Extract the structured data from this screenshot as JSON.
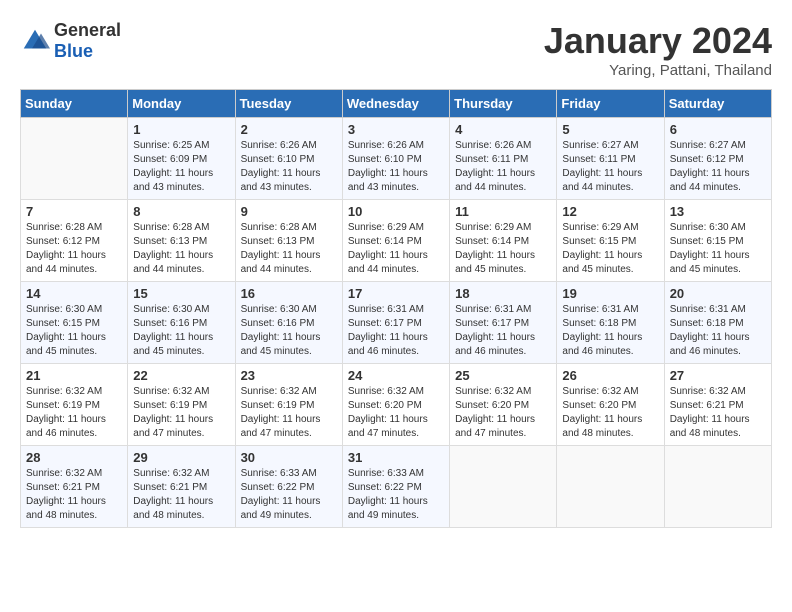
{
  "header": {
    "logo_general": "General",
    "logo_blue": "Blue",
    "month": "January 2024",
    "location": "Yaring, Pattani, Thailand"
  },
  "columns": [
    "Sunday",
    "Monday",
    "Tuesday",
    "Wednesday",
    "Thursday",
    "Friday",
    "Saturday"
  ],
  "weeks": [
    [
      {
        "day": "",
        "info": ""
      },
      {
        "day": "1",
        "info": "Sunrise: 6:25 AM\nSunset: 6:09 PM\nDaylight: 11 hours\nand 43 minutes."
      },
      {
        "day": "2",
        "info": "Sunrise: 6:26 AM\nSunset: 6:10 PM\nDaylight: 11 hours\nand 43 minutes."
      },
      {
        "day": "3",
        "info": "Sunrise: 6:26 AM\nSunset: 6:10 PM\nDaylight: 11 hours\nand 43 minutes."
      },
      {
        "day": "4",
        "info": "Sunrise: 6:26 AM\nSunset: 6:11 PM\nDaylight: 11 hours\nand 44 minutes."
      },
      {
        "day": "5",
        "info": "Sunrise: 6:27 AM\nSunset: 6:11 PM\nDaylight: 11 hours\nand 44 minutes."
      },
      {
        "day": "6",
        "info": "Sunrise: 6:27 AM\nSunset: 6:12 PM\nDaylight: 11 hours\nand 44 minutes."
      }
    ],
    [
      {
        "day": "7",
        "info": "Sunrise: 6:28 AM\nSunset: 6:12 PM\nDaylight: 11 hours\nand 44 minutes."
      },
      {
        "day": "8",
        "info": "Sunrise: 6:28 AM\nSunset: 6:13 PM\nDaylight: 11 hours\nand 44 minutes."
      },
      {
        "day": "9",
        "info": "Sunrise: 6:28 AM\nSunset: 6:13 PM\nDaylight: 11 hours\nand 44 minutes."
      },
      {
        "day": "10",
        "info": "Sunrise: 6:29 AM\nSunset: 6:14 PM\nDaylight: 11 hours\nand 44 minutes."
      },
      {
        "day": "11",
        "info": "Sunrise: 6:29 AM\nSunset: 6:14 PM\nDaylight: 11 hours\nand 45 minutes."
      },
      {
        "day": "12",
        "info": "Sunrise: 6:29 AM\nSunset: 6:15 PM\nDaylight: 11 hours\nand 45 minutes."
      },
      {
        "day": "13",
        "info": "Sunrise: 6:30 AM\nSunset: 6:15 PM\nDaylight: 11 hours\nand 45 minutes."
      }
    ],
    [
      {
        "day": "14",
        "info": "Sunrise: 6:30 AM\nSunset: 6:15 PM\nDaylight: 11 hours\nand 45 minutes."
      },
      {
        "day": "15",
        "info": "Sunrise: 6:30 AM\nSunset: 6:16 PM\nDaylight: 11 hours\nand 45 minutes."
      },
      {
        "day": "16",
        "info": "Sunrise: 6:30 AM\nSunset: 6:16 PM\nDaylight: 11 hours\nand 45 minutes."
      },
      {
        "day": "17",
        "info": "Sunrise: 6:31 AM\nSunset: 6:17 PM\nDaylight: 11 hours\nand 46 minutes."
      },
      {
        "day": "18",
        "info": "Sunrise: 6:31 AM\nSunset: 6:17 PM\nDaylight: 11 hours\nand 46 minutes."
      },
      {
        "day": "19",
        "info": "Sunrise: 6:31 AM\nSunset: 6:18 PM\nDaylight: 11 hours\nand 46 minutes."
      },
      {
        "day": "20",
        "info": "Sunrise: 6:31 AM\nSunset: 6:18 PM\nDaylight: 11 hours\nand 46 minutes."
      }
    ],
    [
      {
        "day": "21",
        "info": "Sunrise: 6:32 AM\nSunset: 6:19 PM\nDaylight: 11 hours\nand 46 minutes."
      },
      {
        "day": "22",
        "info": "Sunrise: 6:32 AM\nSunset: 6:19 PM\nDaylight: 11 hours\nand 47 minutes."
      },
      {
        "day": "23",
        "info": "Sunrise: 6:32 AM\nSunset: 6:19 PM\nDaylight: 11 hours\nand 47 minutes."
      },
      {
        "day": "24",
        "info": "Sunrise: 6:32 AM\nSunset: 6:20 PM\nDaylight: 11 hours\nand 47 minutes."
      },
      {
        "day": "25",
        "info": "Sunrise: 6:32 AM\nSunset: 6:20 PM\nDaylight: 11 hours\nand 47 minutes."
      },
      {
        "day": "26",
        "info": "Sunrise: 6:32 AM\nSunset: 6:20 PM\nDaylight: 11 hours\nand 48 minutes."
      },
      {
        "day": "27",
        "info": "Sunrise: 6:32 AM\nSunset: 6:21 PM\nDaylight: 11 hours\nand 48 minutes."
      }
    ],
    [
      {
        "day": "28",
        "info": "Sunrise: 6:32 AM\nSunset: 6:21 PM\nDaylight: 11 hours\nand 48 minutes."
      },
      {
        "day": "29",
        "info": "Sunrise: 6:32 AM\nSunset: 6:21 PM\nDaylight: 11 hours\nand 48 minutes."
      },
      {
        "day": "30",
        "info": "Sunrise: 6:33 AM\nSunset: 6:22 PM\nDaylight: 11 hours\nand 49 minutes."
      },
      {
        "day": "31",
        "info": "Sunrise: 6:33 AM\nSunset: 6:22 PM\nDaylight: 11 hours\nand 49 minutes."
      },
      {
        "day": "",
        "info": ""
      },
      {
        "day": "",
        "info": ""
      },
      {
        "day": "",
        "info": ""
      }
    ]
  ]
}
